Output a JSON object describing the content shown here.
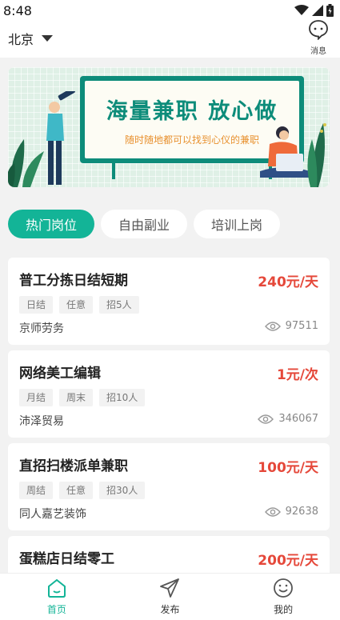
{
  "status_bar": {
    "time": "8:48"
  },
  "header": {
    "city": "北京",
    "message_label": "消息"
  },
  "banner": {
    "title": "海量兼职 放心做",
    "subtitle": "随时随地都可以找到心仪的兼职"
  },
  "tabs": [
    {
      "label": "热门岗位",
      "active": true
    },
    {
      "label": "自由副业",
      "active": false
    },
    {
      "label": "培训上岗",
      "active": false
    }
  ],
  "jobs": [
    {
      "title": "普工分拣日结短期",
      "price": "240元/天",
      "tags": [
        "日结",
        "任意",
        "招5人"
      ],
      "company": "京师劳务",
      "views": "97511"
    },
    {
      "title": "网络美工编辑",
      "price": "1元/次",
      "tags": [
        "月结",
        "周末",
        "招10人"
      ],
      "company": "沛泽贸易",
      "views": "346067"
    },
    {
      "title": "直招扫楼派单兼职",
      "price": "100元/天",
      "tags": [
        "周结",
        "任意",
        "招30人"
      ],
      "company": "同人嘉艺装饰",
      "views": "92638"
    },
    {
      "title": "蛋糕店日结零工",
      "price": "200元/天",
      "tags": [],
      "company": "",
      "views": ""
    }
  ],
  "bottom_nav": [
    {
      "label": "首页",
      "icon": "home-icon",
      "active": true
    },
    {
      "label": "发布",
      "icon": "send-icon",
      "active": false
    },
    {
      "label": "我的",
      "icon": "smile-icon",
      "active": false
    }
  ],
  "colors": {
    "accent": "#13b497",
    "price": "#e5483a",
    "board": "#0d8c7a"
  }
}
